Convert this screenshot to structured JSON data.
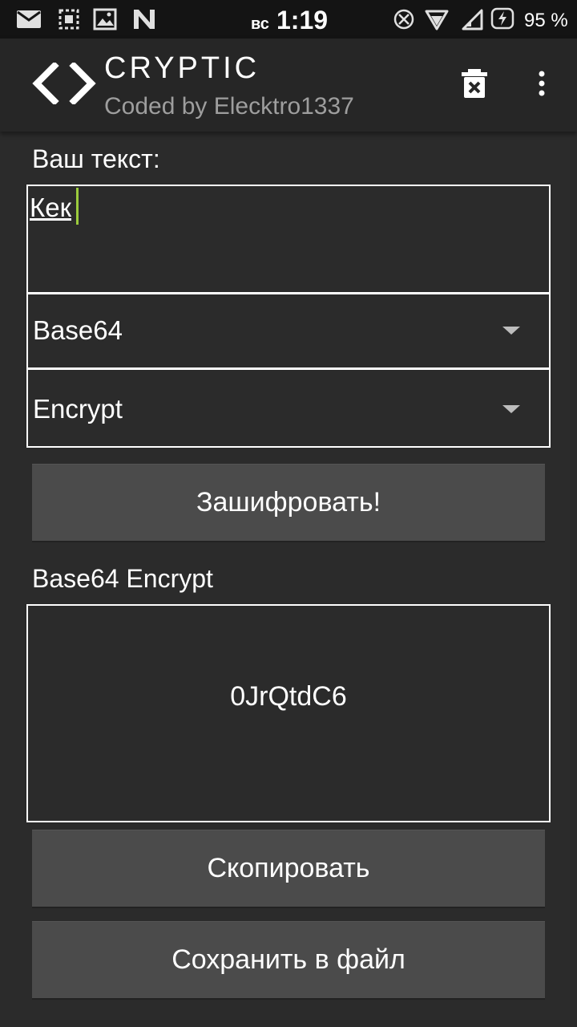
{
  "status_bar": {
    "day": "вс",
    "time": "1:19",
    "battery_percent": "95 %",
    "icons": [
      "mail-icon",
      "screenshot-icon",
      "image-icon",
      "n-icon",
      "blocked-icon",
      "wifi-icon",
      "signal-icon",
      "battery-charging-icon"
    ]
  },
  "app_bar": {
    "title": "CRYPTIC",
    "subtitle": "Coded by Elecktro1337",
    "icons": [
      "code-brackets-icon",
      "trash-icon",
      "more-vert-icon"
    ]
  },
  "form": {
    "input_label": "Ваш текст:",
    "input_value": "Кек",
    "algorithm_selected": "Base64",
    "mode_selected": "Encrypt",
    "encrypt_button": "Зашифровать!"
  },
  "result": {
    "label": "Base64 Encrypt",
    "value": "0JrQtdC6",
    "copy_button": "Скопировать",
    "save_button": "Сохранить в файл"
  },
  "colors": {
    "background": "#2b2b2b",
    "app_bar": "#262626",
    "status_bar": "#141414",
    "button": "#4b4b4b",
    "caret": "#9ccc3d"
  }
}
